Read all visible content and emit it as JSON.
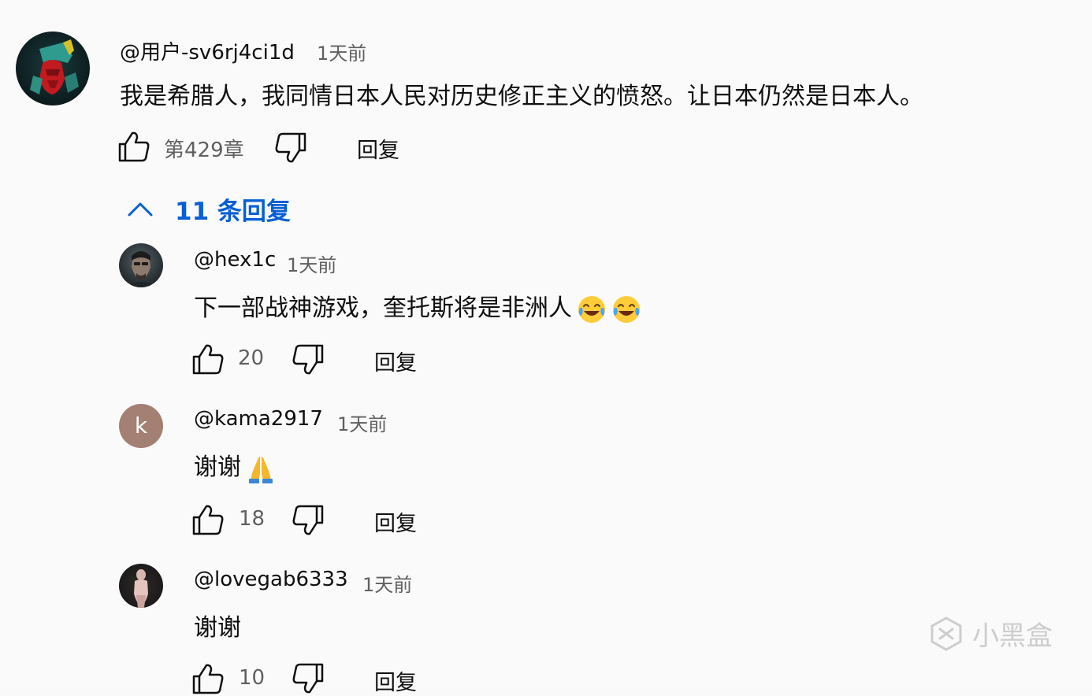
{
  "main_comment": {
    "username": "@用户-sv6rj4ci1d",
    "timestamp": "1天前",
    "text": "我是希腊人，我同情日本人民对历史修正主义的愤怒。让日本仍然是日本人。",
    "like_count": "第429章",
    "reply_label": "回复"
  },
  "replies_toggle": {
    "label": "11 条回复"
  },
  "replies": [
    {
      "username": "@hex1c",
      "timestamp": "1天前",
      "text": "下一部战神游戏，奎托斯将是非洲人",
      "emoji_count": 2,
      "emoji": "face-with-tears-of-joy",
      "like_count": "20",
      "reply_label": "回复",
      "avatar_letter": ""
    },
    {
      "username": "@kama2917",
      "timestamp": "1天前",
      "text": "谢谢",
      "emoji": "folded-hands",
      "like_count": "18",
      "reply_label": "回复",
      "avatar_letter": "k",
      "avatar_color": "#a47f73"
    },
    {
      "username": "@lovegab6333",
      "timestamp": "1天前",
      "text": "谢谢",
      "like_count": "10",
      "reply_label": "回复"
    }
  ],
  "watermark": {
    "text": "小黑盒"
  },
  "colors": {
    "link_blue": "#065fd4",
    "secondary_text": "#606060",
    "primary_text": "#0f0f0f"
  }
}
